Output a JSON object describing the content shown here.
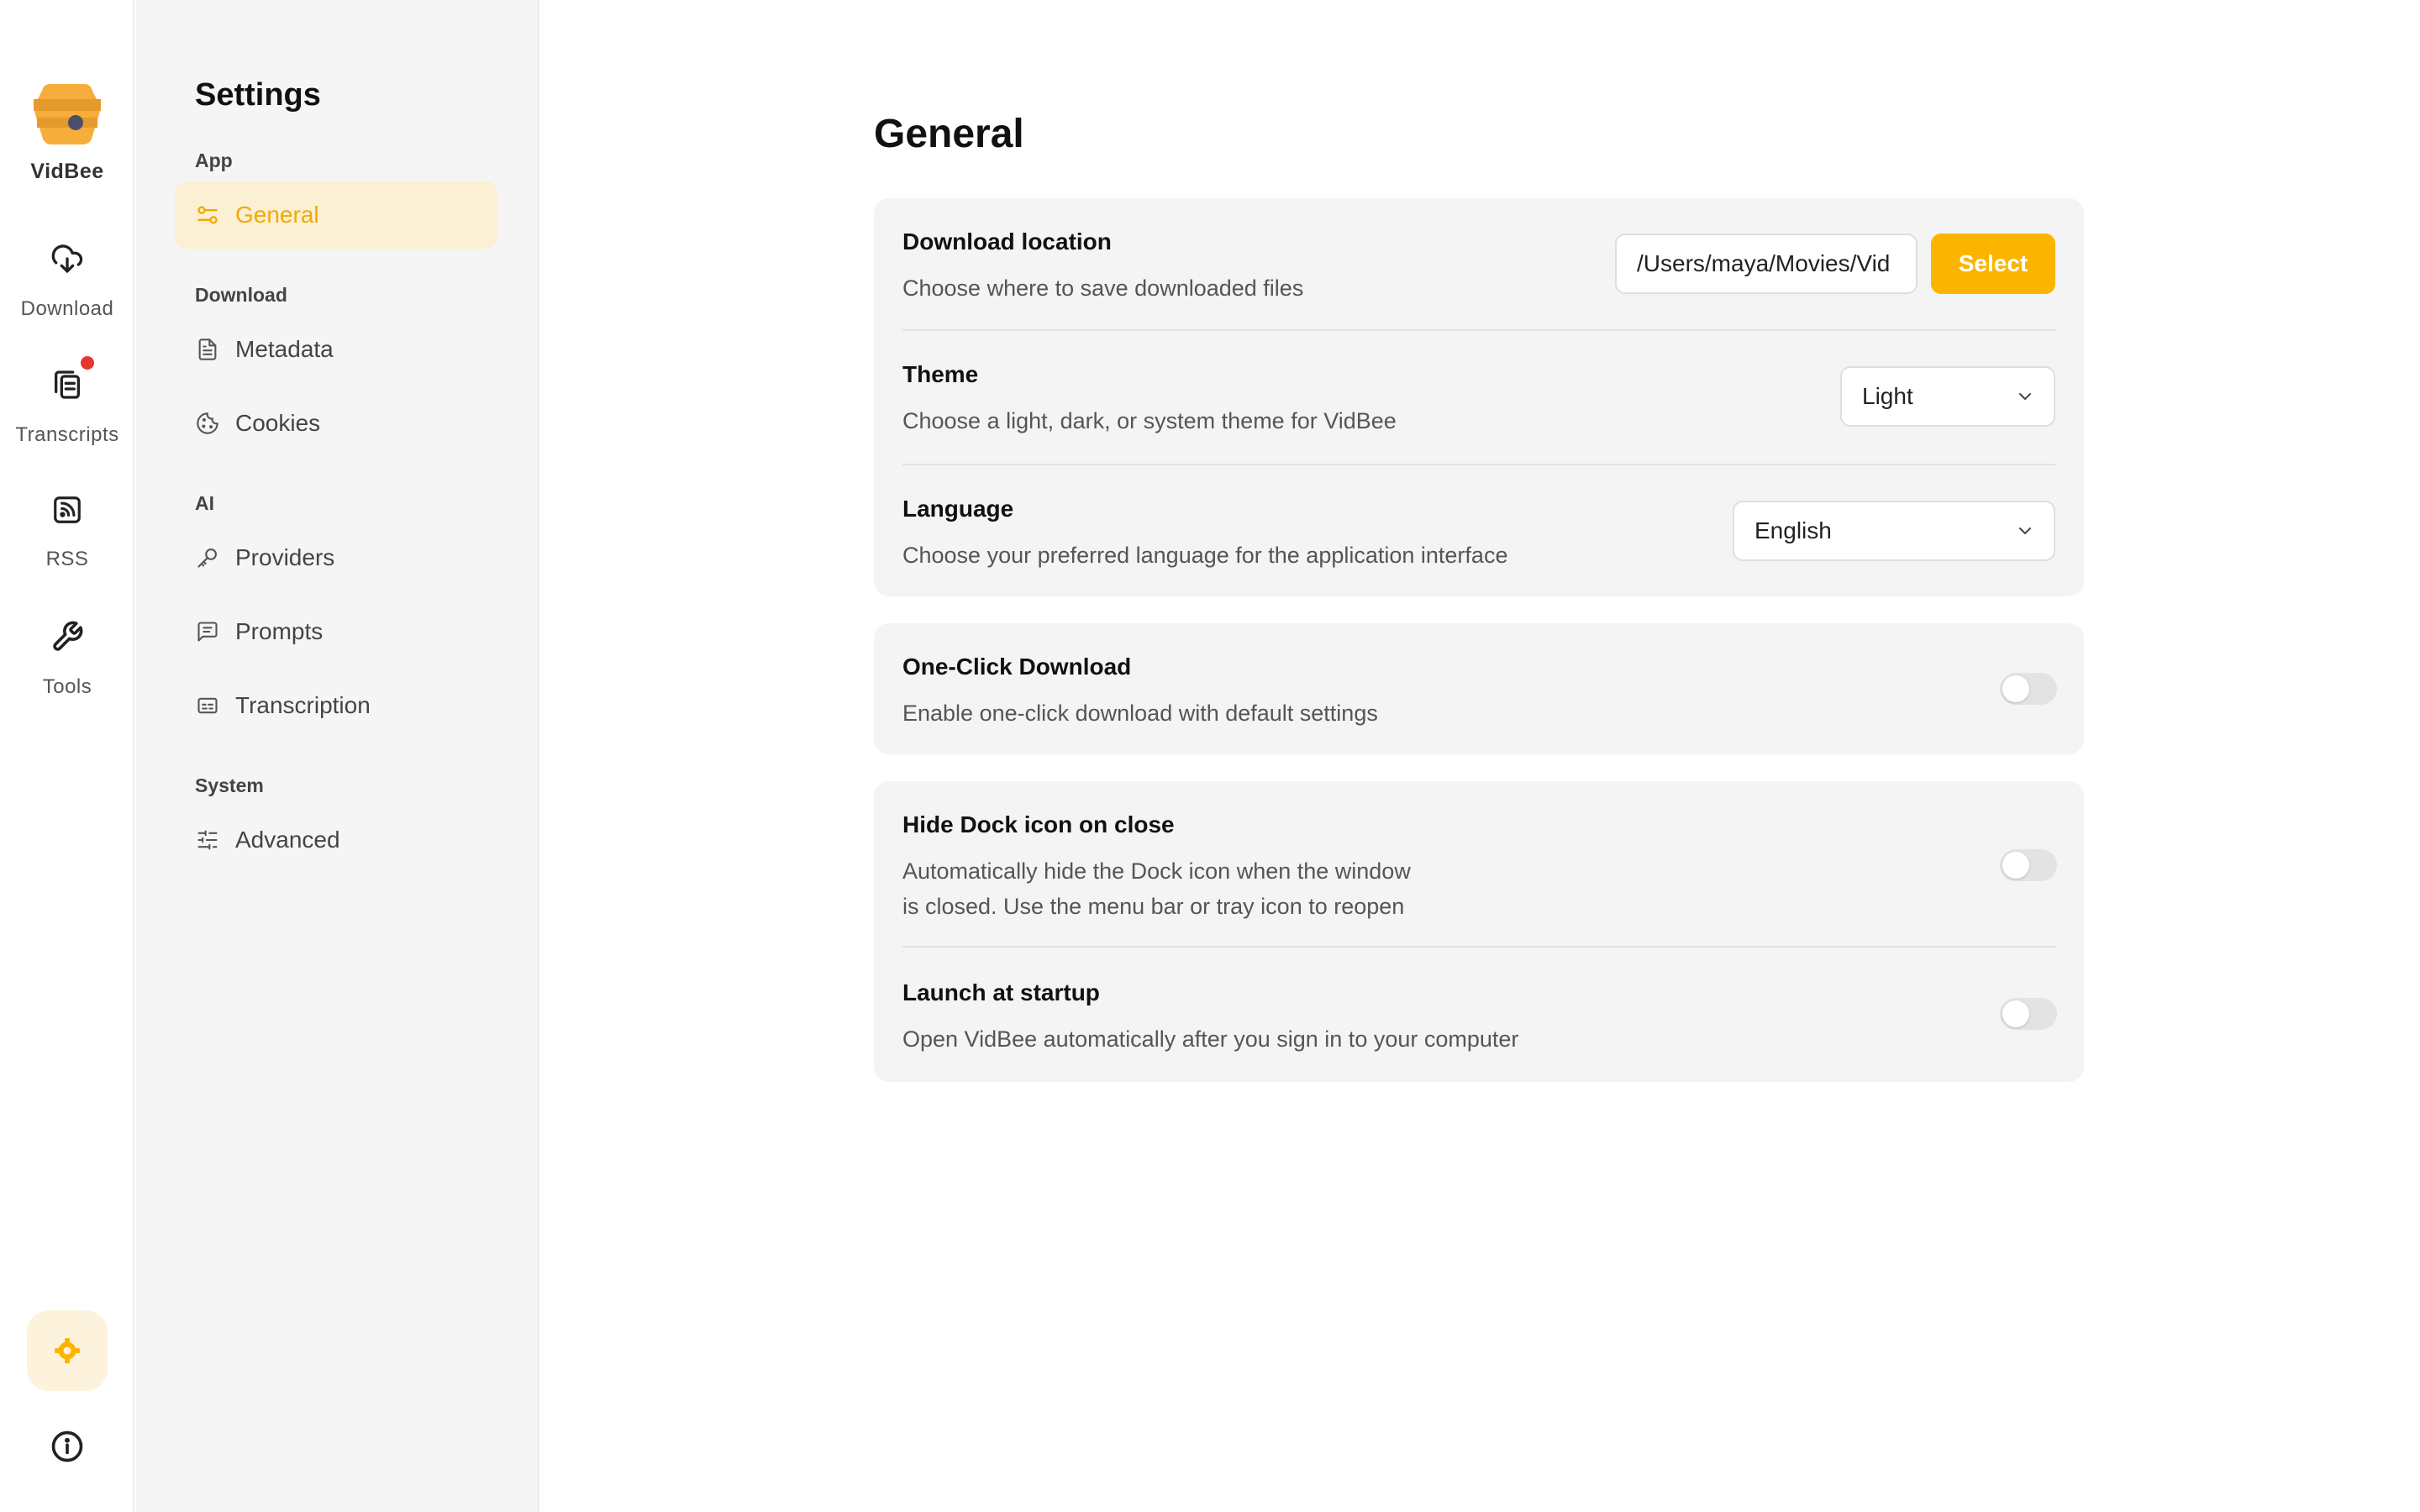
{
  "app": {
    "name": "VidBee"
  },
  "rail": {
    "items": [
      {
        "label": "Download",
        "icon": "download-cloud-icon"
      },
      {
        "label": "Transcripts",
        "icon": "documents-icon",
        "badge_color": "#e5372f"
      },
      {
        "label": "RSS",
        "icon": "rss-icon"
      },
      {
        "label": "Tools",
        "icon": "wrench-icon"
      }
    ],
    "bottom": {
      "settings_icon": "gear-icon",
      "info_icon": "info-icon"
    }
  },
  "sidebar": {
    "title": "Settings",
    "groups": [
      {
        "label": "App",
        "items": [
          {
            "label": "General",
            "icon": "sliders-icon",
            "active": true
          }
        ]
      },
      {
        "label": "Download",
        "items": [
          {
            "label": "Metadata",
            "icon": "file-text-icon"
          },
          {
            "label": "Cookies",
            "icon": "cookie-icon"
          }
        ]
      },
      {
        "label": "AI",
        "items": [
          {
            "label": "Providers",
            "icon": "key-icon"
          },
          {
            "label": "Prompts",
            "icon": "message-square-icon"
          },
          {
            "label": "Transcription",
            "icon": "captions-icon"
          }
        ]
      },
      {
        "label": "System",
        "items": [
          {
            "label": "Advanced",
            "icon": "sliders-horizontal-icon"
          }
        ]
      }
    ]
  },
  "main": {
    "title": "General",
    "download_location": {
      "title": "Download location",
      "desc": "Choose where to save downloaded files",
      "path": "/Users/maya/Movies/Vid",
      "button": "Select"
    },
    "theme": {
      "title": "Theme",
      "desc": "Choose a light, dark, or system theme for VidBee",
      "value": "Light"
    },
    "language": {
      "title": "Language",
      "desc": "Choose your preferred language for the application interface",
      "value": "English"
    },
    "one_click": {
      "title": "One-Click Download",
      "desc": "Enable one-click download with default settings",
      "enabled": false
    },
    "hide_dock": {
      "title": "Hide Dock icon on close",
      "desc_line1": "Automatically hide the Dock icon when the window",
      "desc_line2": "is closed. Use the menu bar or tray icon to reopen",
      "enabled": false
    },
    "launch_startup": {
      "title": "Launch at startup",
      "desc": "Open VidBee automatically after you sign in to your computer",
      "enabled": false
    }
  },
  "colors": {
    "accent": "#fbb500",
    "accent_text": "#f2a900",
    "active_bg": "#fbefd4",
    "card_bg": "#f4f4f4",
    "sidebar_bg": "#f5f5f5"
  }
}
